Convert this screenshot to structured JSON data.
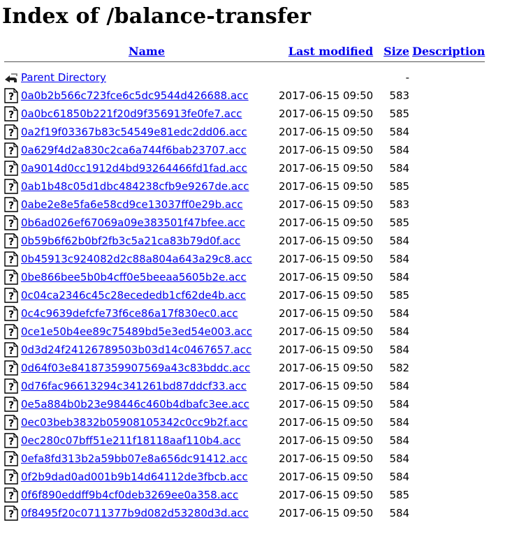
{
  "title": "Index of /balance-transfer",
  "columns": {
    "name": "Name",
    "last_modified": "Last modified",
    "size": "Size",
    "description": "Description"
  },
  "parent": {
    "label": "Parent Directory",
    "size": "-",
    "icon": "back-arrow-icon"
  },
  "files": [
    {
      "name": "0a0b2b566c723fce6c5dc9544d426688.acc",
      "date": "2017-06-15 09:50",
      "size": "583"
    },
    {
      "name": "0a0bc61850b221f20d9f356913fe0fe7.acc",
      "date": "2017-06-15 09:50",
      "size": "585"
    },
    {
      "name": "0a2f19f03367b83c54549e81edc2dd06.acc",
      "date": "2017-06-15 09:50",
      "size": "584"
    },
    {
      "name": "0a629f4d2a830c2ca6a744f6bab23707.acc",
      "date": "2017-06-15 09:50",
      "size": "584"
    },
    {
      "name": "0a9014d0cc1912d4bd93264466fd1fad.acc",
      "date": "2017-06-15 09:50",
      "size": "584"
    },
    {
      "name": "0ab1b48c05d1dbc484238cfb9e9267de.acc",
      "date": "2017-06-15 09:50",
      "size": "585"
    },
    {
      "name": "0abe2e8e5fa6e58cd9ce13037ff0e29b.acc",
      "date": "2017-06-15 09:50",
      "size": "583"
    },
    {
      "name": "0b6ad026ef67069a09e383501f47bfee.acc",
      "date": "2017-06-15 09:50",
      "size": "585"
    },
    {
      "name": "0b59b6f62b0bf2fb3c5a21ca83b79d0f.acc",
      "date": "2017-06-15 09:50",
      "size": "584"
    },
    {
      "name": "0b45913c924082d2c88a804a643a29c8.acc",
      "date": "2017-06-15 09:50",
      "size": "584"
    },
    {
      "name": "0be866bee5b0b4cff0e5beeaa5605b2e.acc",
      "date": "2017-06-15 09:50",
      "size": "584"
    },
    {
      "name": "0c04ca2346c45c28ecededb1cf62de4b.acc",
      "date": "2017-06-15 09:50",
      "size": "585"
    },
    {
      "name": "0c4c9639defcfe73f6ce86a17f830ec0.acc",
      "date": "2017-06-15 09:50",
      "size": "584"
    },
    {
      "name": "0ce1e50b4ee89c75489bd5e3ed54e003.acc",
      "date": "2017-06-15 09:50",
      "size": "584"
    },
    {
      "name": "0d3d24f24126789503b03d14c0467657.acc",
      "date": "2017-06-15 09:50",
      "size": "584"
    },
    {
      "name": "0d64f03e84187359907569a43c83bddc.acc",
      "date": "2017-06-15 09:50",
      "size": "582"
    },
    {
      "name": "0d76fac96613294c341261bd87ddcf33.acc",
      "date": "2017-06-15 09:50",
      "size": "584"
    },
    {
      "name": "0e5a884b0b23e98446c460b4dbafc3ee.acc",
      "date": "2017-06-15 09:50",
      "size": "584"
    },
    {
      "name": "0ec03beb3832b05908105342c0cc9b2f.acc",
      "date": "2017-06-15 09:50",
      "size": "584"
    },
    {
      "name": "0ec280c07bff51e211f18118aaf110b4.acc",
      "date": "2017-06-15 09:50",
      "size": "584"
    },
    {
      "name": "0efa8fd313b2a59bb07e8a656dc91412.acc",
      "date": "2017-06-15 09:50",
      "size": "584"
    },
    {
      "name": "0f2b9dad0ad001b9b14d64112de3fbcb.acc",
      "date": "2017-06-15 09:50",
      "size": "584"
    },
    {
      "name": "0f6f890eddff9b4cf0deb3269ee0a358.acc",
      "date": "2017-06-15 09:50",
      "size": "585"
    },
    {
      "name": "0f8495f20c0711377b9d082d53280d3d.acc",
      "date": "2017-06-15 09:50",
      "size": "584"
    }
  ],
  "file_icon": "unknown-file-icon",
  "colors": {
    "link": "#0000ee",
    "text": "#000000",
    "background": "#ffffff"
  }
}
